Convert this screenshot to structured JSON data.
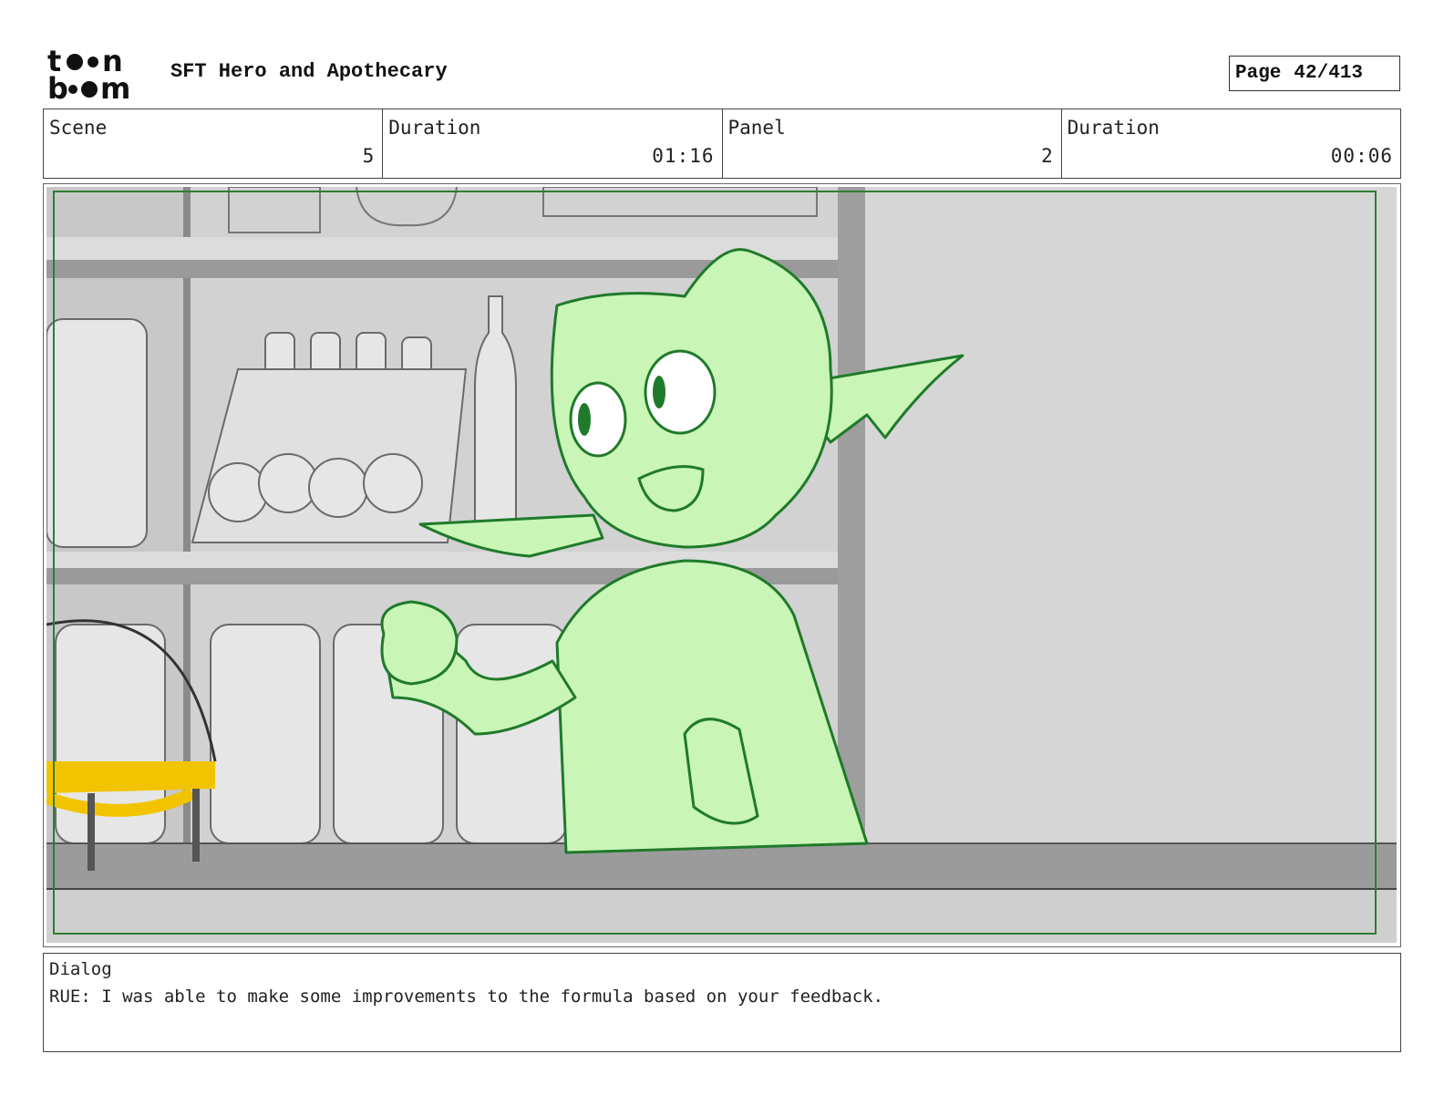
{
  "header": {
    "logo_text": "toon boom",
    "title": "SFT Hero and Apothecary",
    "page_label": "Page",
    "page_value": "42/413"
  },
  "info": {
    "scene_label": "Scene",
    "scene_value": "5",
    "duration_label": "Duration",
    "duration_value": "01:16",
    "panel_label": "Panel",
    "panel_value": "2",
    "panel_duration_label": "Duration",
    "panel_duration_value": "00:06"
  },
  "dialog": {
    "label": "Dialog",
    "text": "RUE: I was able to make some improvements to the formula based on your feedback."
  },
  "colors": {
    "character_fill": "#c9f5b7",
    "character_line": "#1f7a2a",
    "safe_frame": "#2e7d32",
    "shelf_gray": "#9a9a9a",
    "wall_gray": "#d9d9d9",
    "yellow_accent": "#f2c400"
  }
}
